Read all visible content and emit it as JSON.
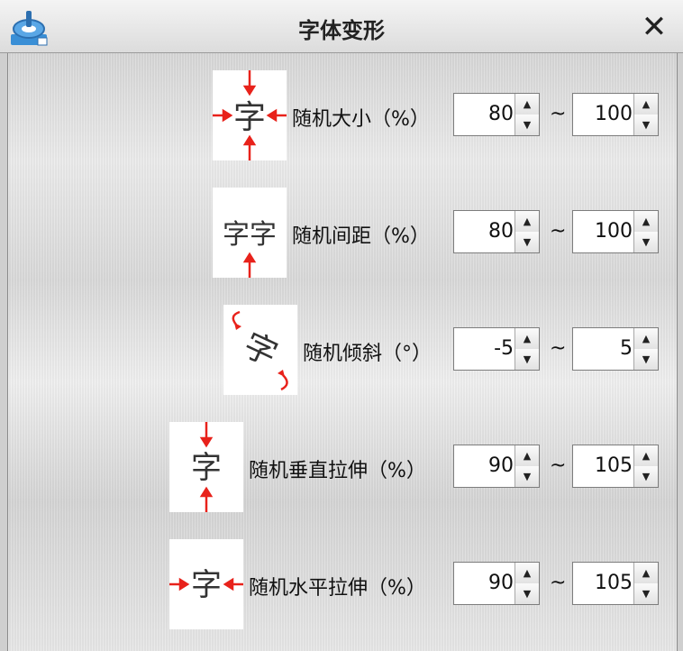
{
  "window": {
    "title": "字体变形",
    "close_glyph": "✕"
  },
  "icons": {
    "app": "app-logo-icon",
    "close": "close-icon",
    "spin_up": "▲",
    "spin_down": "▼"
  },
  "rows": [
    {
      "label": "随机大小（%）",
      "min": "80",
      "max": "100",
      "sample": "字",
      "tilde": "~"
    },
    {
      "label": "随机间距（%）",
      "min": "80",
      "max": "100",
      "sample": "字字",
      "tilde": "~"
    },
    {
      "label": "随机倾斜（°）",
      "min": "-5",
      "max": "5",
      "sample": "字",
      "tilde": "~"
    },
    {
      "label": "随机垂直拉伸（%）",
      "min": "90",
      "max": "105",
      "sample": "字",
      "tilde": "~"
    },
    {
      "label": "随机水平拉伸（%）",
      "min": "90",
      "max": "105",
      "sample": "字",
      "tilde": "~"
    }
  ],
  "colors": {
    "arrow": "#e8221b",
    "icon_blue": "#3a8fd6"
  }
}
